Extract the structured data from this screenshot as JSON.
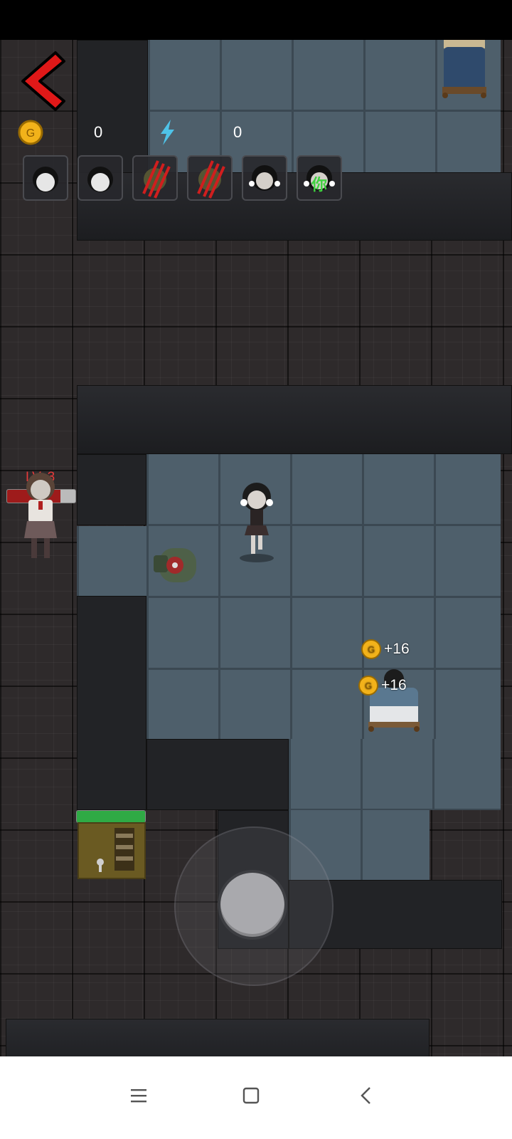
{
  "hud": {
    "coins": "0",
    "energy": "0",
    "slots": [
      {
        "icon": "ghost-face-icon",
        "label": ""
      },
      {
        "icon": "ghost-face-icon",
        "label": ""
      },
      {
        "icon": "claw-scratch-icon",
        "label": ""
      },
      {
        "icon": "claw-scratch-icon",
        "label": ""
      },
      {
        "icon": "girl-face-icon",
        "label": ""
      },
      {
        "icon": "girl-face-icon",
        "label": "你"
      }
    ]
  },
  "enemy": {
    "level": "LV. 3",
    "hp_fraction": 0.78
  },
  "door": {
    "hp_fraction": 1.0
  },
  "rewards": [
    "+16",
    "+16"
  ],
  "colors": {
    "coin": "#f2b21a",
    "accent_red": "#e01818",
    "energy": "#4fc3e8",
    "hp_bar": "#9e1b1b",
    "door_bar": "#2faa45"
  },
  "nav": {
    "menu_icon": "menu-icon",
    "home_icon": "home-icon",
    "back_icon": "back-icon"
  }
}
